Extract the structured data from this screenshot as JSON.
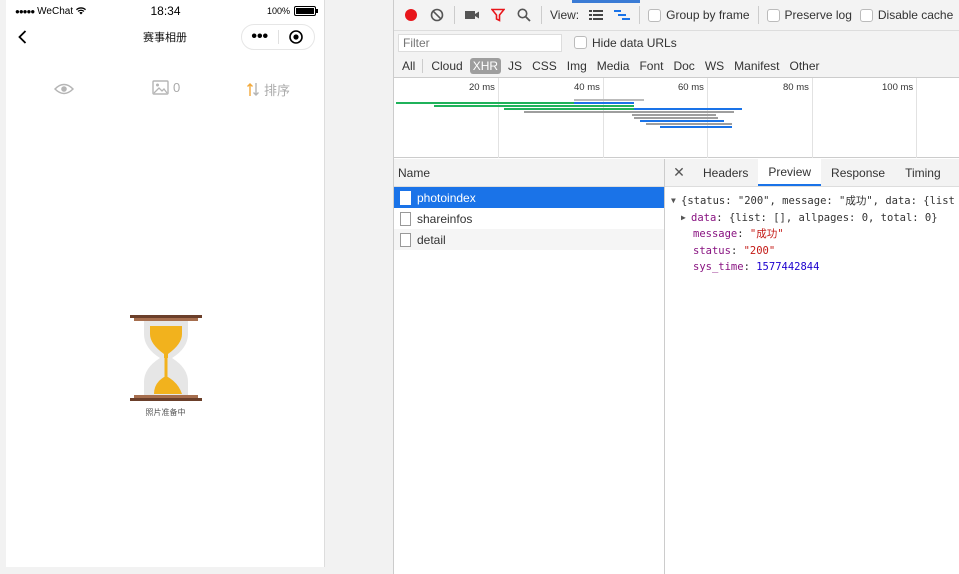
{
  "phone": {
    "status_bar": {
      "signal": "●●●●●",
      "carrier": "WeChat",
      "time": "18:34",
      "battery": "100%"
    },
    "nav": {
      "title": "赛事相册",
      "more": "•••"
    },
    "tabs": {
      "photo_count": "0",
      "sort_label": "排序"
    },
    "loading_text": "照片准备中"
  },
  "devtools": {
    "toolbar": {
      "view_label": "View:",
      "group_by_frame": "Group by frame",
      "preserve_log": "Preserve log",
      "disable_cache": "Disable cache"
    },
    "filter": {
      "placeholder": "Filter",
      "hide_data_urls": "Hide data URLs"
    },
    "types": [
      "All",
      "Cloud",
      "XHR",
      "JS",
      "CSS",
      "Img",
      "Media",
      "Font",
      "Doc",
      "WS",
      "Manifest",
      "Other"
    ],
    "active_type": "XHR",
    "timeline": {
      "ticks": [
        "20 ms",
        "40 ms",
        "60 ms",
        "80 ms",
        "100 ms"
      ]
    },
    "name_header": "Name",
    "requests": [
      {
        "name": "photoindex"
      },
      {
        "name": "shareinfos"
      },
      {
        "name": "detail"
      }
    ],
    "detail_tabs": [
      "Headers",
      "Preview",
      "Response",
      "Timing"
    ],
    "active_detail_tab": "Preview",
    "preview": {
      "summary": "{status: \"200\", message: \"成功\", data: {list",
      "data_line_key": "data",
      "data_line_value": "{list: [], allpages: 0, total: 0}",
      "message_key": "message",
      "message_value": "\"成功\"",
      "status_key": "status",
      "status_value": "\"200\"",
      "sys_time_key": "sys_time",
      "sys_time_value": "1577442844"
    },
    "colors": {
      "record": "#e8161b",
      "accent": "#1a73e8",
      "bar_green": "#1fb25a",
      "bar_blue": "#1a73e8",
      "bar_gray": "#9e9e9e"
    }
  }
}
